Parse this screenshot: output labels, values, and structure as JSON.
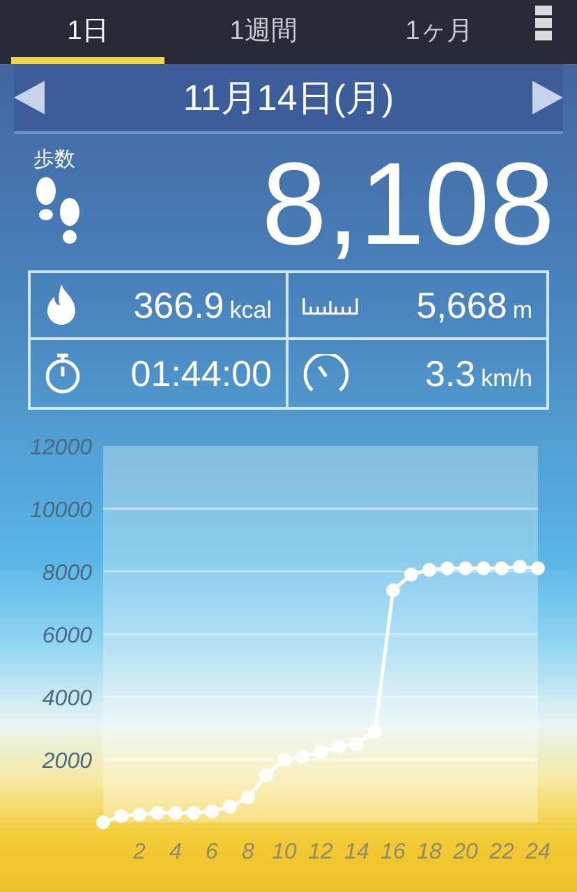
{
  "tabs": [
    {
      "label": "1日",
      "selected": true
    },
    {
      "label": "1週間",
      "selected": false
    },
    {
      "label": "1ヶ月",
      "selected": false
    }
  ],
  "date": "11月14日(月)",
  "steps": {
    "label": "歩数",
    "value": "8,108"
  },
  "stats": [
    {
      "kind": "calories",
      "value": "366.9",
      "unit": "kcal"
    },
    {
      "kind": "distance",
      "value": "5,668",
      "unit": "m"
    },
    {
      "kind": "time",
      "value": "01:44:00"
    },
    {
      "kind": "speed",
      "value": "3.3",
      "unit": "km/h"
    }
  ],
  "chart_data": {
    "type": "line",
    "x": [
      0,
      1,
      2,
      3,
      4,
      5,
      6,
      7,
      8,
      9,
      10,
      11,
      12,
      13,
      14,
      15,
      16,
      17,
      18,
      19,
      20,
      21,
      22,
      23,
      24
    ],
    "series": [
      {
        "color": "#ffffff",
        "marker": true,
        "values": [
          0,
          200,
          250,
          300,
          300,
          300,
          350,
          500,
          800,
          1500,
          2000,
          2100,
          2250,
          2400,
          2500,
          2900,
          7400,
          7900,
          8050,
          8100,
          8100,
          8100,
          8100,
          8150,
          8100
        ]
      }
    ],
    "grid": true,
    "xlim": [
      0,
      24
    ],
    "ylim": [
      0,
      12000
    ],
    "xticks": [
      2,
      4,
      6,
      8,
      10,
      12,
      14,
      16,
      18,
      20,
      22,
      24
    ],
    "yticks": [
      2000,
      4000,
      6000,
      8000,
      10000,
      12000
    ]
  }
}
